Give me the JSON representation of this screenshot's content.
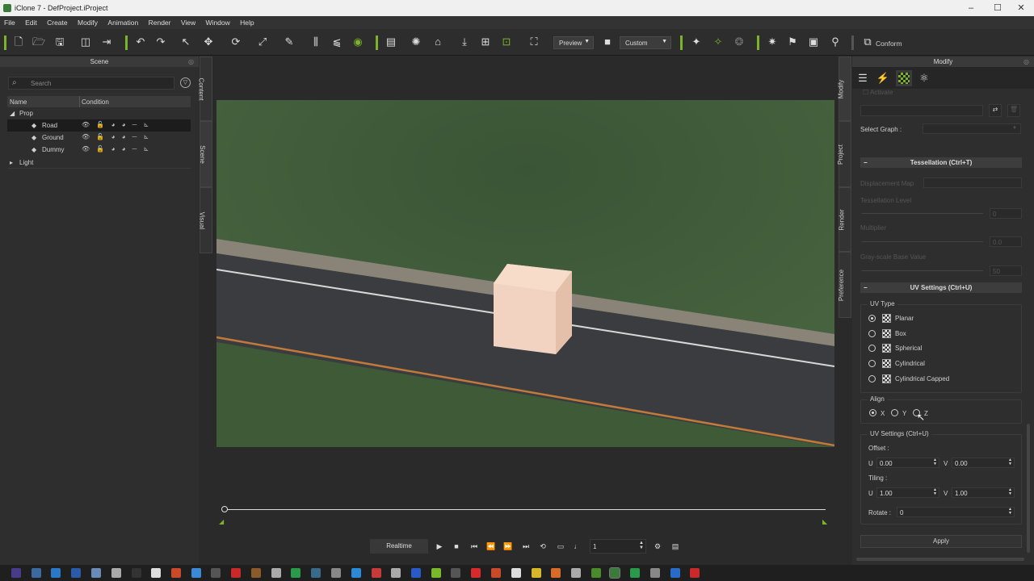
{
  "window": {
    "title": "iClone 7 - DefProject.iProject",
    "min": "–",
    "max": "☐",
    "close": "✕"
  },
  "menu": [
    "File",
    "Edit",
    "Create",
    "Modify",
    "Animation",
    "Render",
    "View",
    "Window",
    "Help"
  ],
  "toolbar": {
    "preview_label": "Preview",
    "camera_label": "Custom",
    "conform_label": "Conform",
    "accent": "#7cb32a"
  },
  "scene_panel": {
    "title": "Scene",
    "search_placeholder": "Search",
    "col_name": "Name",
    "col_condition": "Condition",
    "tree": [
      {
        "label": "Prop",
        "expanded": true
      },
      {
        "label": "Road",
        "selected": true
      },
      {
        "label": "Ground"
      },
      {
        "label": "Dummy"
      },
      {
        "label": "Light",
        "expanded": false
      }
    ]
  },
  "left_tabs": [
    "Content",
    "Scene",
    "Visual"
  ],
  "right_tabs": [
    "Modify",
    "Project",
    "Render",
    "Preference"
  ],
  "modify": {
    "title": "Modify",
    "activate": "Activate",
    "select_graph": "Select Graph :",
    "tess_header": "Tessellation (Ctrl+T)",
    "displacement_map": "Displacement Map",
    "tess_level": "Tessellation Level",
    "tess_level_val": "0",
    "multiplier": "Multiplier",
    "multiplier_val": "0.0",
    "gray_base": "Gray-scale Base Value",
    "gray_base_val": "50",
    "uv_header": "UV Settings (Ctrl+U)",
    "uv_type_label": "UV Type",
    "uv_types": [
      "Planar",
      "Box",
      "Spherical",
      "Cylindrical",
      "Cylindrical Capped"
    ],
    "uv_type_selected": "Planar",
    "align_label": "Align",
    "align_options": [
      "X",
      "Y",
      "Z"
    ],
    "align_selected": "X",
    "uv_settings_label": "UV Settings (Ctrl+U)",
    "offset_label": "Offset :",
    "tiling_label": "Tiling :",
    "u_label": "U",
    "v_label": "V",
    "offset_u": "0.00",
    "offset_v": "0.00",
    "tiling_u": "1.00",
    "tiling_v": "1.00",
    "rotate_label": "Rotate :",
    "rotate_val": "0",
    "apply_label": "Apply"
  },
  "playback": {
    "realtime": "Realtime",
    "frame": "1"
  }
}
